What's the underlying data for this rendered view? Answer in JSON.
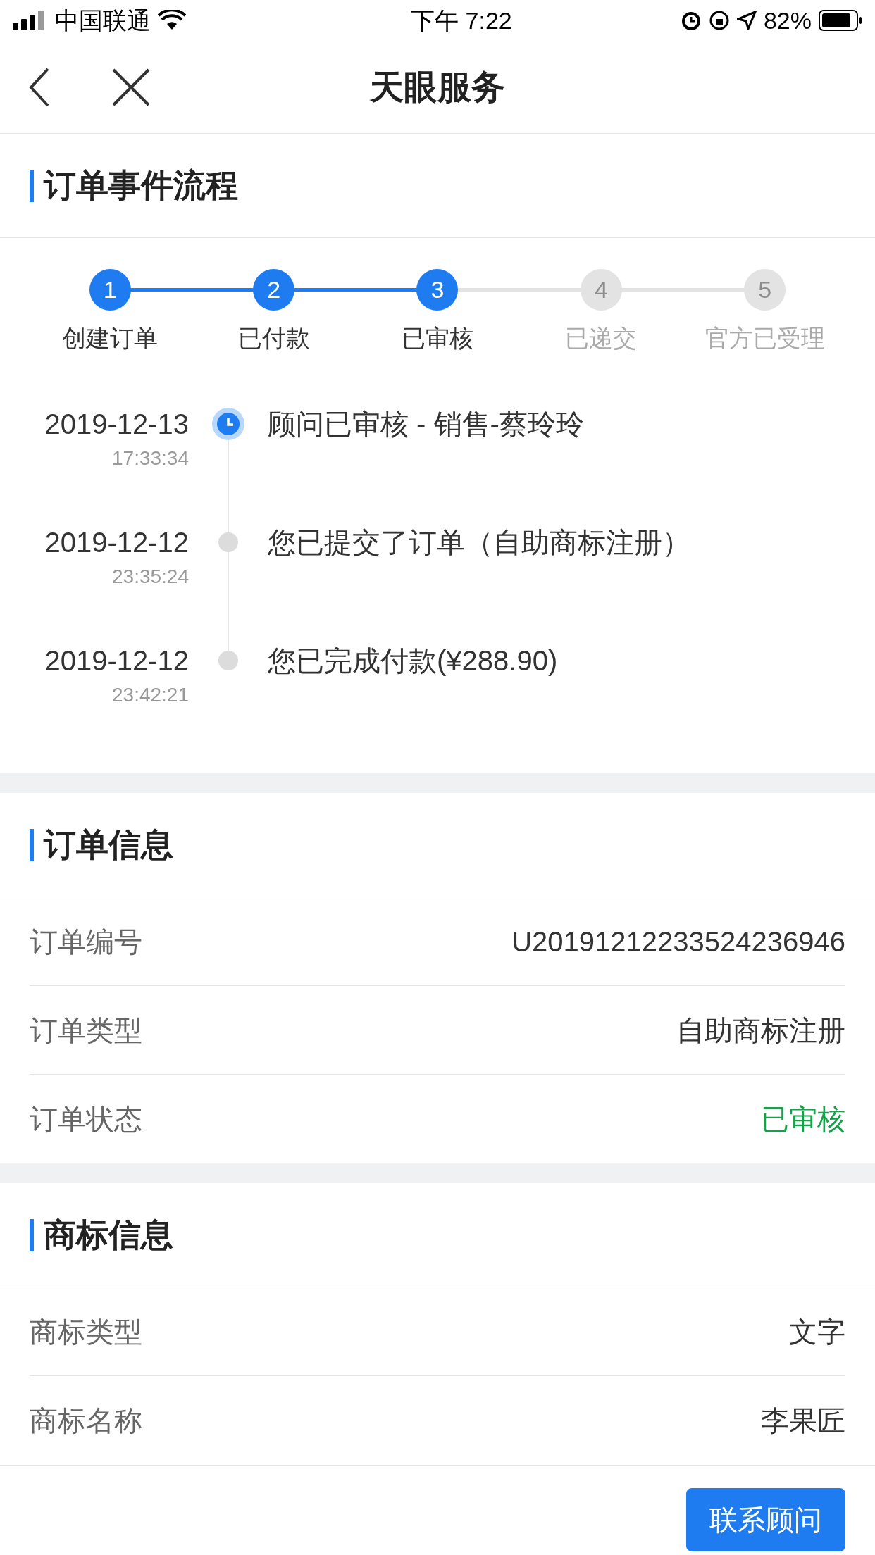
{
  "status_bar": {
    "carrier": "中国联通",
    "time": "下午 7:22",
    "battery": "82%"
  },
  "nav": {
    "title": "天眼服务"
  },
  "process": {
    "title": "订单事件流程",
    "steps": [
      {
        "number": "1",
        "label": "创建订单",
        "done": true
      },
      {
        "number": "2",
        "label": "已付款",
        "done": true
      },
      {
        "number": "3",
        "label": "已审核",
        "done": true
      },
      {
        "number": "4",
        "label": "已递交",
        "done": false
      },
      {
        "number": "5",
        "label": "官方已受理",
        "done": false
      }
    ],
    "events": [
      {
        "date": "2019-12-13",
        "time": "17:33:34",
        "text": "顾问已审核 - 销售-蔡玲玲",
        "current": true
      },
      {
        "date": "2019-12-12",
        "time": "23:35:24",
        "text": "您已提交了订单（自助商标注册）",
        "current": false
      },
      {
        "date": "2019-12-12",
        "time": "23:42:21",
        "text": "您已完成付款(¥288.90)",
        "current": false
      }
    ]
  },
  "order_info": {
    "title": "订单信息",
    "rows": [
      {
        "label": "订单编号",
        "value": "U20191212233524236946",
        "kind": "text"
      },
      {
        "label": "订单类型",
        "value": "自助商标注册",
        "kind": "text"
      },
      {
        "label": "订单状态",
        "value": "已审核",
        "kind": "status"
      }
    ]
  },
  "trademark_info": {
    "title": "商标信息",
    "rows": [
      {
        "label": "商标类型",
        "value": "文字",
        "kind": "text"
      },
      {
        "label": "商标名称",
        "value": "李果匠",
        "kind": "text"
      }
    ]
  },
  "contact_button": "联系顾问"
}
